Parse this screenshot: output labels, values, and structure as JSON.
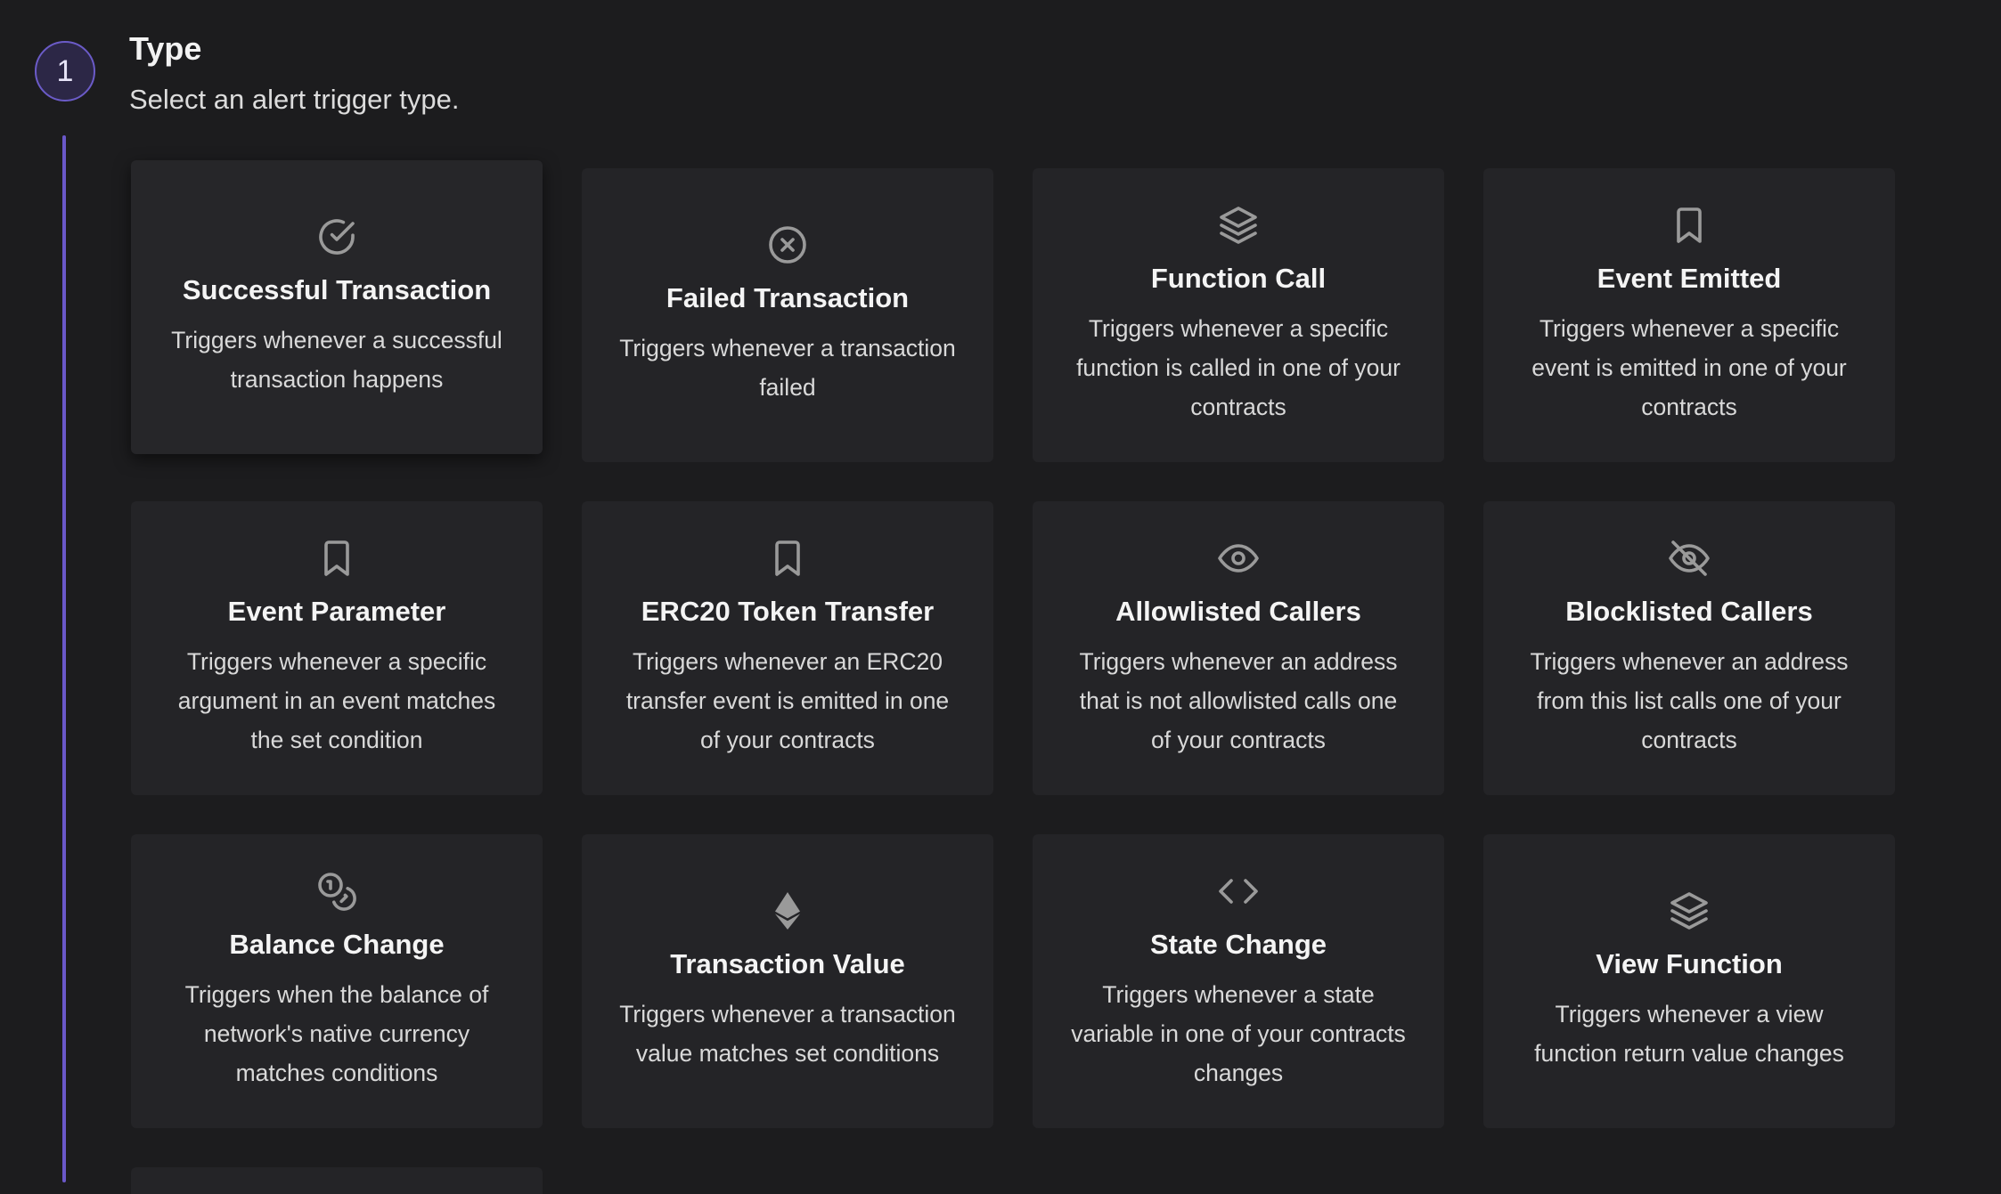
{
  "step": {
    "number": "1",
    "title": "Type",
    "subtitle": "Select an alert trigger type."
  },
  "cards": [
    {
      "title": "Successful Transaction",
      "description": "Triggers whenever a successful transaction happens",
      "icon": "check-circle-icon",
      "selected": true
    },
    {
      "title": "Failed Transaction",
      "description": "Triggers whenever a transaction failed",
      "icon": "x-circle-icon"
    },
    {
      "title": "Function Call",
      "description": "Triggers whenever a specific function is called in one of your contracts",
      "icon": "layers-icon"
    },
    {
      "title": "Event Emitted",
      "description": "Triggers whenever a specific event is emitted in one of your contracts",
      "icon": "bookmark-icon"
    },
    {
      "title": "Event Parameter",
      "description": "Triggers whenever a specific argument in an event matches the set condition",
      "icon": "bookmark-icon"
    },
    {
      "title": "ERC20 Token Transfer",
      "description": "Triggers whenever an ERC20 transfer event is emitted in one of your contracts",
      "icon": "bookmark-icon"
    },
    {
      "title": "Allowlisted Callers",
      "description": "Triggers whenever an address that is not allowlisted calls one of your contracts",
      "icon": "eye-icon"
    },
    {
      "title": "Blocklisted Callers",
      "description": "Triggers whenever an address from this list calls one of your contracts",
      "icon": "eye-off-icon"
    },
    {
      "title": "Balance Change",
      "description": "Triggers when the balance of network's native currency matches conditions",
      "icon": "coins-icon"
    },
    {
      "title": "Transaction Value",
      "description": "Triggers whenever a transaction value matches set conditions",
      "icon": "ethereum-icon"
    },
    {
      "title": "State Change",
      "description": "Triggers whenever a state variable in one of your contracts changes",
      "icon": "code-icon"
    },
    {
      "title": "View Function",
      "description": "Triggers whenever a view function return value changes",
      "icon": "layers-icon"
    }
  ],
  "colors": {
    "background": "#1c1c1e",
    "card": "#242427",
    "accent": "#6a58c9",
    "icon": "#9a9a9a"
  }
}
